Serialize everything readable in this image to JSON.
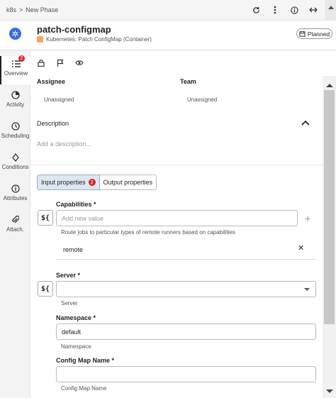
{
  "breadcrumb": {
    "root": "k8s",
    "separator": ">",
    "current": "New Phase"
  },
  "topbar_icons": [
    "refresh-icon",
    "more-vertical-icon",
    "info-icon",
    "expand-horizontal-icon"
  ],
  "task": {
    "title": "patch-configmap",
    "subtitle": "Kubernetes: Patch ConfigMap (Container)",
    "status": "Planned"
  },
  "sidebar": {
    "items": [
      {
        "label": "Overview",
        "icon": "list-icon",
        "badge": "2",
        "active": true
      },
      {
        "label": "Activity",
        "icon": "pie-icon"
      },
      {
        "label": "Scheduling",
        "icon": "clock-icon"
      },
      {
        "label": "Conditions",
        "icon": "diamond-icon"
      },
      {
        "label": "Attributes",
        "icon": "info-icon"
      },
      {
        "label": "Attach.",
        "icon": "paperclip-icon"
      }
    ]
  },
  "toolbar_icons": [
    "lock-icon",
    "flag-icon",
    "eye-icon"
  ],
  "assignment": {
    "assignee_label": "Assignee",
    "assignee_value": "Unassigned",
    "team_label": "Team",
    "team_value": "Unassigned"
  },
  "description": {
    "label": "Description",
    "placeholder": "Add a description..."
  },
  "tabs": [
    {
      "label": "Input properties",
      "badge": "2",
      "active": true
    },
    {
      "label": "Output properties"
    }
  ],
  "fields": {
    "capabilities": {
      "label": "Capabilities *",
      "placeholder": "Add new value",
      "help": "Route jobs to particular types of remote runners based on capabilities",
      "values": [
        "remote"
      ]
    },
    "server": {
      "label": "Server *",
      "value": "",
      "help": "Server"
    },
    "namespace": {
      "label": "Namespace *",
      "value": "default",
      "help": "Namespace"
    },
    "config_map_name": {
      "label": "Config Map Name *",
      "value": "",
      "help": "Config Map Name"
    }
  },
  "expression_button": "${",
  "colors": {
    "accent": "#326ce5",
    "badge": "#d9262c",
    "tab_active": "#dde7f2"
  }
}
